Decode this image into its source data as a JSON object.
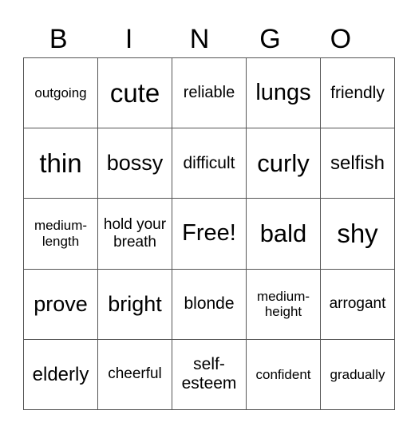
{
  "header": [
    "B",
    "I",
    "N",
    "G",
    "O"
  ],
  "rows": [
    [
      {
        "text": "outgoing",
        "size": "s17"
      },
      {
        "text": "cute",
        "size": "s33"
      },
      {
        "text": "reliable",
        "size": "s20"
      },
      {
        "text": "lungs",
        "size": "s29"
      },
      {
        "text": "friendly",
        "size": "s21"
      }
    ],
    [
      {
        "text": "thin",
        "size": "s33"
      },
      {
        "text": "bossy",
        "size": "s27"
      },
      {
        "text": "difficult",
        "size": "s21"
      },
      {
        "text": "curly",
        "size": "s31"
      },
      {
        "text": "selfish",
        "size": "s24"
      }
    ],
    [
      {
        "text": "medium-length",
        "size": "s17"
      },
      {
        "text": "hold your breath",
        "size": "s19"
      },
      {
        "text": "Free!",
        "size": "s29"
      },
      {
        "text": "bald",
        "size": "s31"
      },
      {
        "text": "shy",
        "size": "s33"
      }
    ],
    [
      {
        "text": "prove",
        "size": "s27"
      },
      {
        "text": "bright",
        "size": "s27"
      },
      {
        "text": "blonde",
        "size": "s21"
      },
      {
        "text": "medium-height",
        "size": "s17"
      },
      {
        "text": "arrogant",
        "size": "s19"
      }
    ],
    [
      {
        "text": "elderly",
        "size": "s24"
      },
      {
        "text": "cheerful",
        "size": "s19"
      },
      {
        "text": "self-esteem",
        "size": "s21"
      },
      {
        "text": "confident",
        "size": "s17"
      },
      {
        "text": "gradually",
        "size": "s17"
      }
    ]
  ]
}
